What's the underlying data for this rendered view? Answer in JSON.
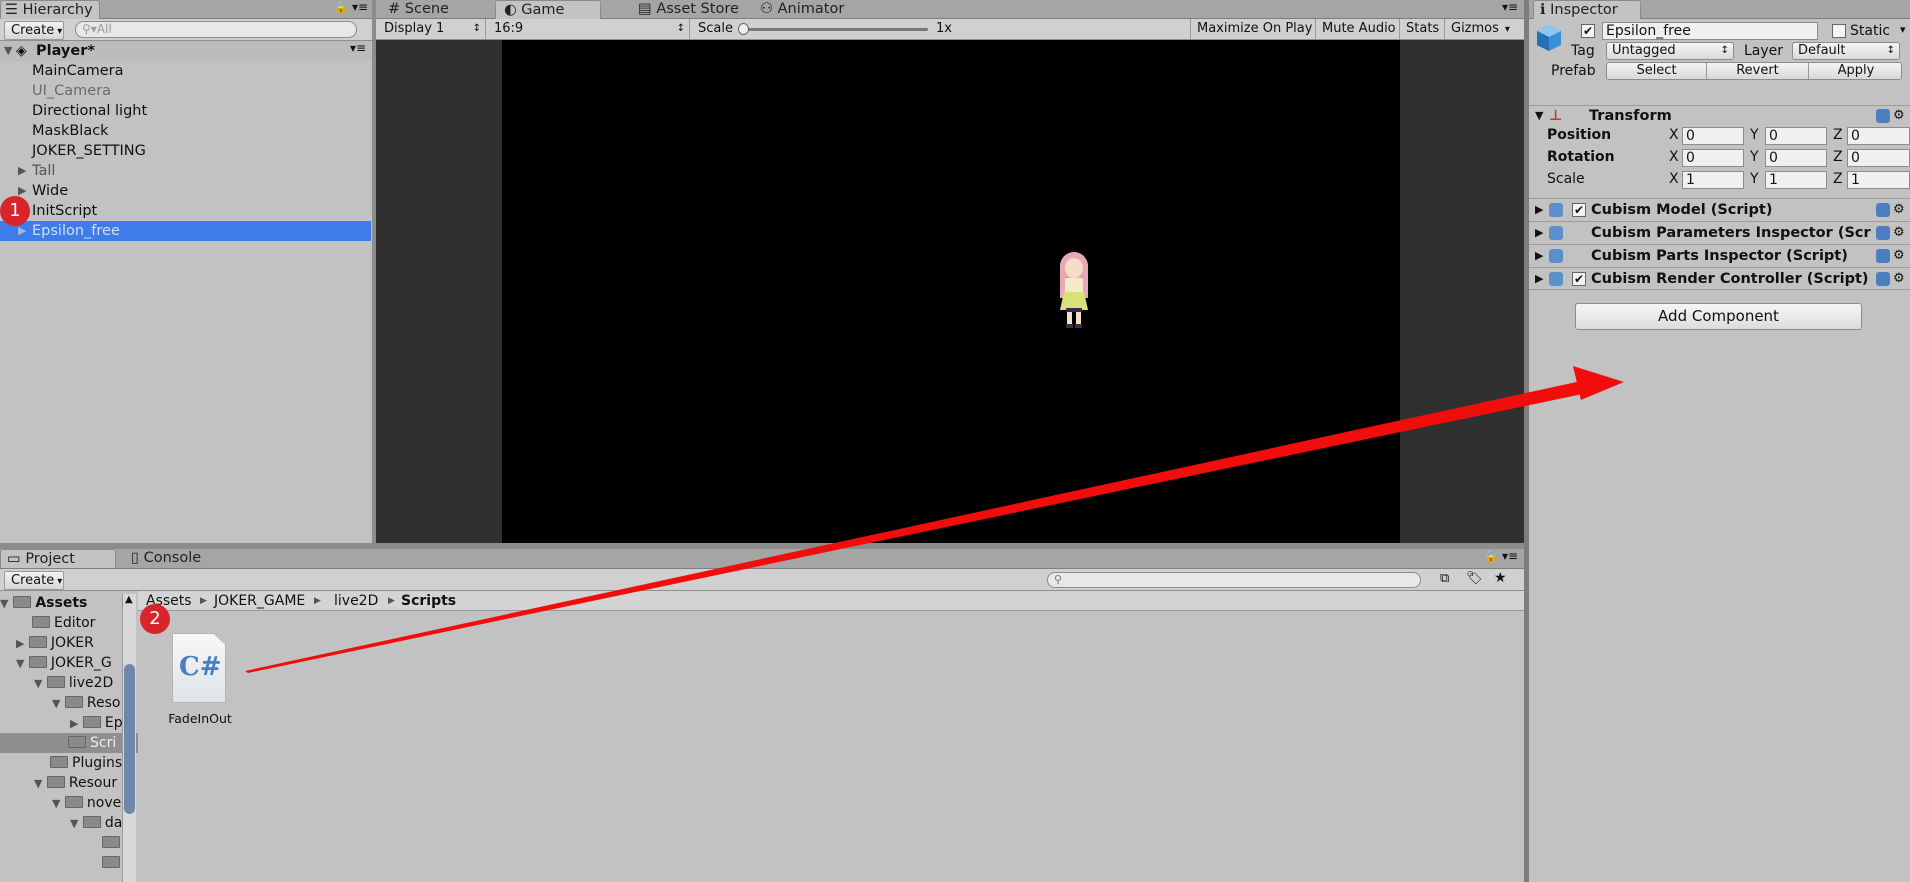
{
  "hierarchy": {
    "tab_label": "Hierarchy",
    "create_label": "Create",
    "search_placeholder": "All",
    "scene_name": "Player*",
    "items": [
      {
        "label": "MainCamera"
      },
      {
        "label": "UI_Camera"
      },
      {
        "label": "Directional light"
      },
      {
        "label": "MaskBlack"
      },
      {
        "label": "JOKER_SETTING"
      },
      {
        "label": "Tall"
      },
      {
        "label": "Wide"
      },
      {
        "label": "InitScript"
      },
      {
        "label": "Epsilon_free"
      }
    ],
    "selected_color": "#3e7ce9"
  },
  "game_view": {
    "tabs": [
      "Scene",
      "Game",
      "Asset Store",
      "Animator"
    ],
    "display": "Display 1",
    "aspect": "16:9",
    "scale_label": "Scale",
    "scale_value": "1x",
    "buttons": [
      "Maximize On Play",
      "Mute Audio",
      "Stats",
      "Gizmos"
    ]
  },
  "inspector": {
    "tab_label": "Inspector",
    "object_name": "Epsilon_free",
    "static_label": "Static",
    "tag_label": "Tag",
    "tag_value": "Untagged",
    "layer_label": "Layer",
    "layer_value": "Default",
    "prefab_label": "Prefab",
    "prefab_buttons": [
      "Select",
      "Revert",
      "Apply"
    ],
    "transform_title": "Transform",
    "transform_rows": [
      {
        "label": "Position",
        "x": "0",
        "y": "0",
        "z": "0"
      },
      {
        "label": "Rotation",
        "x": "0",
        "y": "0",
        "z": "0"
      },
      {
        "label": "Scale",
        "x": "1",
        "y": "1",
        "z": "1"
      }
    ],
    "axis_labels": [
      "X",
      "Y",
      "Z"
    ],
    "components": [
      "Cubism Model (Script)",
      "Cubism Parameters Inspector (Script)",
      "Cubism Parts Inspector (Script)",
      "Cubism Render Controller (Script)"
    ],
    "add_component_label": "Add Component"
  },
  "project": {
    "tabs": [
      "Project",
      "Console"
    ],
    "create_label": "Create",
    "tree": [
      "Assets",
      "Editor",
      "JOKER",
      "JOKER_G",
      "live2D",
      "Reso",
      "Ep",
      "Scri",
      "Plugins",
      "Resour",
      "nove",
      "da"
    ],
    "breadcrumb": [
      "Assets",
      "JOKER_GAME",
      "live2D",
      "Scripts"
    ],
    "asset_name": "FadeInOut",
    "asset_glyph": "C#"
  },
  "annotations": {
    "badge_1": "1",
    "badge_2": "2",
    "arrow_color": "#f20d0d"
  }
}
